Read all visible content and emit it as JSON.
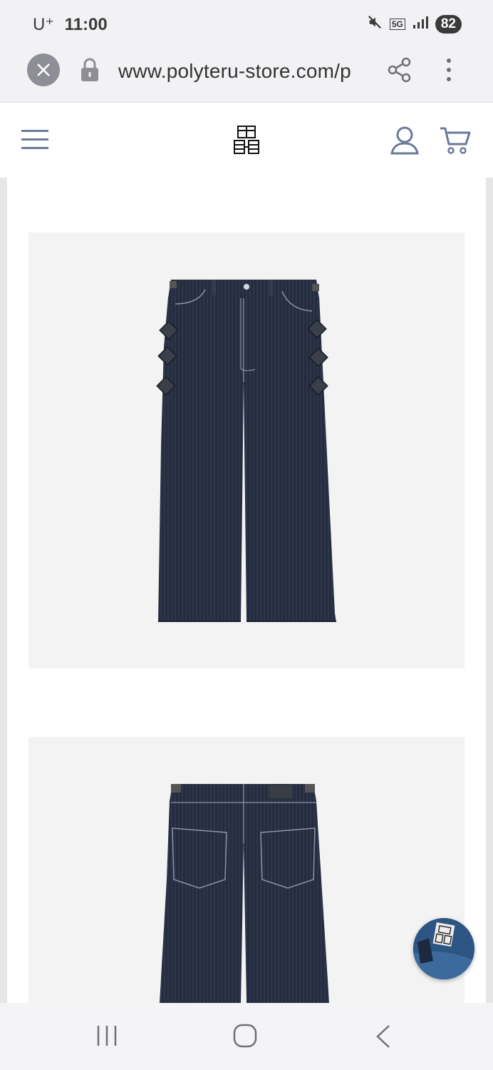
{
  "status_bar": {
    "carrier": "U⁺",
    "time": "11:00",
    "network": "5G",
    "battery": "82",
    "icons": [
      "mute-icon",
      "network-5g-icon",
      "signal-icon",
      "battery-icon"
    ]
  },
  "browser": {
    "url": "www.polyteru-store.com/p",
    "icons": [
      "close-icon",
      "lock-icon",
      "share-icon",
      "more-vertical-icon"
    ]
  },
  "site_header": {
    "icons": [
      "hamburger-menu-icon",
      "brand-logo",
      "account-icon",
      "cart-icon"
    ]
  },
  "product_images": [
    {
      "view": "front",
      "subject": "dark denim trousers front"
    },
    {
      "view": "back",
      "subject": "dark denim trousers back"
    }
  ],
  "colors": {
    "chrome_bg": "#f2f2f5",
    "icon_slate": "#6b7a99",
    "denim": "#232a3e",
    "image_bg": "#f3f3f3"
  },
  "nav_bar": {
    "icons": [
      "recent-apps-icon",
      "home-icon",
      "back-icon"
    ]
  }
}
